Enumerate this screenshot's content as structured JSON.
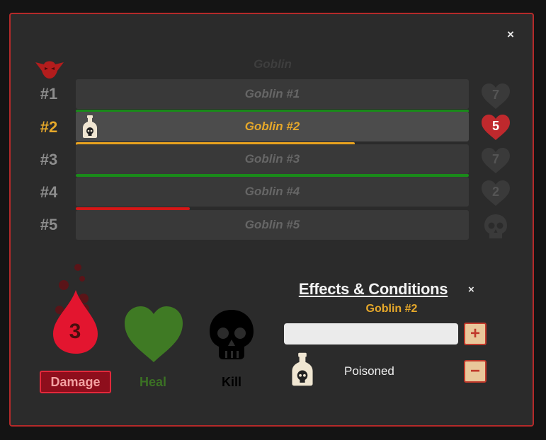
{
  "dialog": {
    "close_label": "×"
  },
  "group": {
    "title": "Goblin"
  },
  "combatants": [
    {
      "number": "#1",
      "name": "Goblin #1",
      "hp": "7",
      "hp_fraction": 1.0,
      "hp_color": "#1a8a1a",
      "active": false,
      "effect_icon": false,
      "dead": false
    },
    {
      "number": "#2",
      "name": "Goblin #2",
      "hp": "5",
      "hp_fraction": 0.71,
      "hp_color": "#e8a21f",
      "active": true,
      "effect_icon": true,
      "dead": false
    },
    {
      "number": "#3",
      "name": "Goblin #3",
      "hp": "7",
      "hp_fraction": 1.0,
      "hp_color": "#1a8a1a",
      "active": false,
      "effect_icon": false,
      "dead": false
    },
    {
      "number": "#4",
      "name": "Goblin #4",
      "hp": "2",
      "hp_fraction": 0.29,
      "hp_color": "#d41717",
      "active": false,
      "effect_icon": false,
      "dead": false
    },
    {
      "number": "#5",
      "name": "Goblin #5",
      "hp": "",
      "hp_fraction": 0,
      "hp_color": "",
      "active": false,
      "effect_icon": false,
      "dead": true
    }
  ],
  "actions": {
    "damage_value": "3",
    "damage_label": "Damage",
    "heal_label": "Heal",
    "kill_label": "Kill"
  },
  "effects": {
    "title": "Effects & Conditions",
    "close_label": "×",
    "target": "Goblin #2",
    "input_value": "",
    "add_label": "+",
    "items": [
      {
        "name": "Poisoned",
        "remove_label": "−"
      }
    ]
  },
  "colors": {
    "accent": "#e6a82a",
    "border": "#b52a2a",
    "damage": "#e3283b",
    "heal": "#3b7124"
  }
}
